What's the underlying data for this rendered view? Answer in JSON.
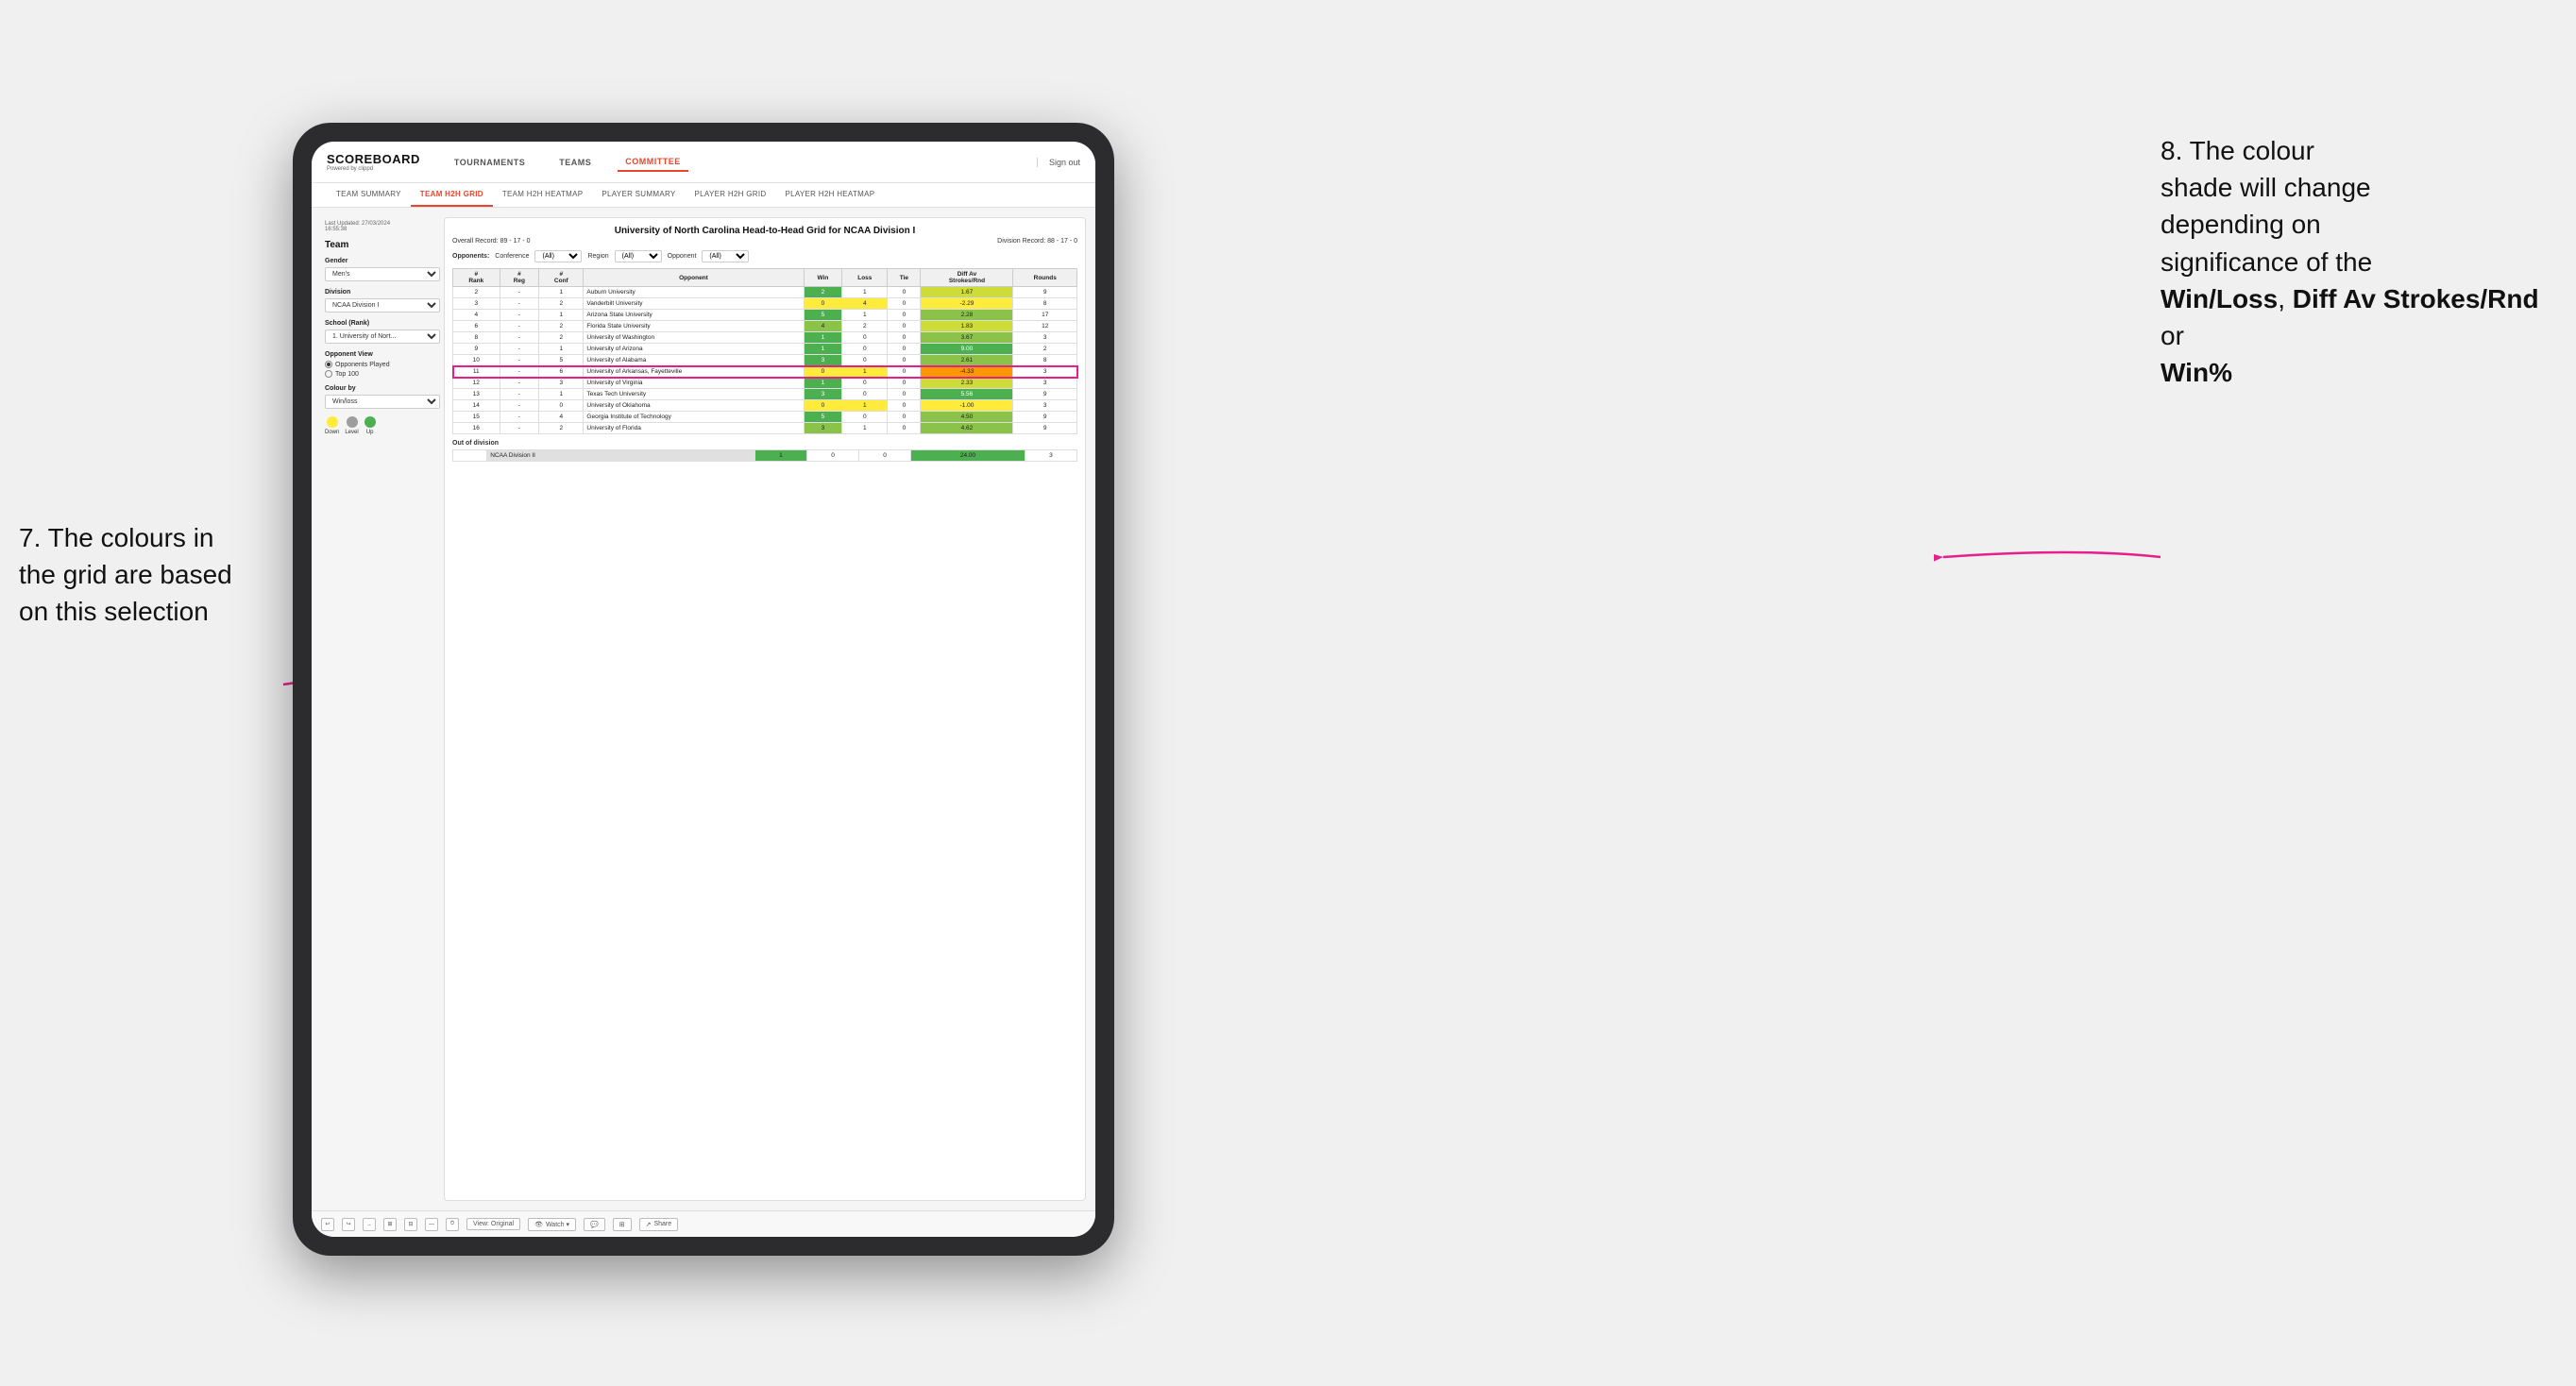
{
  "annotations": {
    "left": {
      "line1": "7. The colours in",
      "line2": "the grid are based",
      "line3": "on this selection"
    },
    "right": {
      "line1": "8. The colour",
      "line2": "shade will change",
      "line3": "depending on",
      "line4": "significance of the",
      "bold1": "Win/Loss",
      "comma1": ", ",
      "bold2": "Diff Av Strokes/Rnd",
      "or": " or",
      "bold3": "Win%"
    }
  },
  "header": {
    "logo": "SCOREBOARD",
    "logo_sub": "Powered by clippd",
    "nav": [
      "TOURNAMENTS",
      "TEAMS",
      "COMMITTEE"
    ],
    "active_nav": "COMMITTEE",
    "sign_out": "Sign out"
  },
  "sub_nav": {
    "items": [
      "TEAM SUMMARY",
      "TEAM H2H GRID",
      "TEAM H2H HEATMAP",
      "PLAYER SUMMARY",
      "PLAYER H2H GRID",
      "PLAYER H2H HEATMAP"
    ],
    "active": "TEAM H2H GRID"
  },
  "left_panel": {
    "update": "Last Updated: 27/03/2024",
    "update_time": "16:55:38",
    "team_label": "Team",
    "gender_label": "Gender",
    "gender_value": "Men's",
    "division_label": "Division",
    "division_value": "NCAA Division I",
    "school_label": "School (Rank)",
    "school_value": "1. University of Nort...",
    "opponent_view_label": "Opponent View",
    "opponent_options": [
      "Opponents Played",
      "Top 100"
    ],
    "opponent_selected": "Opponents Played",
    "colour_by_label": "Colour by",
    "colour_by_value": "Win/loss",
    "colours": [
      {
        "label": "Down",
        "color": "#ffeb3b"
      },
      {
        "label": "Level",
        "color": "#9e9e9e"
      },
      {
        "label": "Up",
        "color": "#4caf50"
      }
    ]
  },
  "grid": {
    "title": "University of North Carolina Head-to-Head Grid for NCAA Division I",
    "overall_record": "Overall Record: 89 - 17 - 0",
    "division_record": "Division Record: 88 - 17 - 0",
    "filter_opponents_label": "Opponents:",
    "filter_conference_label": "Conference",
    "filter_region_label": "Region",
    "filter_opponent_label": "Opponent",
    "filter_all": "(All)",
    "columns": [
      "#\nRank",
      "#\nReg",
      "#\nConf",
      "Opponent",
      "Win",
      "Loss",
      "Tie",
      "Diff Av\nStrokes/Rnd",
      "Rounds"
    ],
    "rows": [
      {
        "rank": "2",
        "reg": "-",
        "conf": "1",
        "opponent": "Auburn University",
        "win": "2",
        "loss": "1",
        "tie": "0",
        "diff": "1.67",
        "rounds": "9",
        "win_color": "green-dark",
        "diff_color": "green-light"
      },
      {
        "rank": "3",
        "reg": "-",
        "conf": "2",
        "opponent": "Vanderbilt University",
        "win": "0",
        "loss": "4",
        "tie": "0",
        "diff": "-2.29",
        "rounds": "8",
        "win_color": "yellow",
        "diff_color": "yellow"
      },
      {
        "rank": "4",
        "reg": "-",
        "conf": "1",
        "opponent": "Arizona State University",
        "win": "5",
        "loss": "1",
        "tie": "0",
        "diff": "2.28",
        "rounds": "17",
        "win_color": "green-dark",
        "diff_color": "green-mid"
      },
      {
        "rank": "6",
        "reg": "-",
        "conf": "2",
        "opponent": "Florida State University",
        "win": "4",
        "loss": "2",
        "tie": "0",
        "diff": "1.83",
        "rounds": "12",
        "win_color": "green-mid",
        "diff_color": "green-light"
      },
      {
        "rank": "8",
        "reg": "-",
        "conf": "2",
        "opponent": "University of Washington",
        "win": "1",
        "loss": "0",
        "tie": "0",
        "diff": "3.67",
        "rounds": "3",
        "win_color": "green-dark",
        "diff_color": "green-mid"
      },
      {
        "rank": "9",
        "reg": "-",
        "conf": "1",
        "opponent": "University of Arizona",
        "win": "1",
        "loss": "0",
        "tie": "0",
        "diff": "9.00",
        "rounds": "2",
        "win_color": "green-dark",
        "diff_color": "green-dark"
      },
      {
        "rank": "10",
        "reg": "-",
        "conf": "5",
        "opponent": "University of Alabama",
        "win": "3",
        "loss": "0",
        "tie": "0",
        "diff": "2.61",
        "rounds": "8",
        "win_color": "green-dark",
        "diff_color": "green-mid"
      },
      {
        "rank": "11",
        "reg": "-",
        "conf": "6",
        "opponent": "University of Arkansas, Fayetteville",
        "win": "0",
        "loss": "1",
        "tie": "0",
        "diff": "-4.33",
        "rounds": "3",
        "win_color": "yellow",
        "diff_color": "orange",
        "highlighted": true
      },
      {
        "rank": "12",
        "reg": "-",
        "conf": "3",
        "opponent": "University of Virginia",
        "win": "1",
        "loss": "0",
        "tie": "0",
        "diff": "2.33",
        "rounds": "3",
        "win_color": "green-dark",
        "diff_color": "green-light"
      },
      {
        "rank": "13",
        "reg": "-",
        "conf": "1",
        "opponent": "Texas Tech University",
        "win": "3",
        "loss": "0",
        "tie": "0",
        "diff": "5.56",
        "rounds": "9",
        "win_color": "green-dark",
        "diff_color": "green-dark"
      },
      {
        "rank": "14",
        "reg": "-",
        "conf": "0",
        "opponent": "University of Oklahoma",
        "win": "0",
        "loss": "1",
        "tie": "0",
        "diff": "-1.00",
        "rounds": "3",
        "win_color": "yellow",
        "diff_color": "yellow"
      },
      {
        "rank": "15",
        "reg": "-",
        "conf": "4",
        "opponent": "Georgia Institute of Technology",
        "win": "5",
        "loss": "0",
        "tie": "0",
        "diff": "4.50",
        "rounds": "9",
        "win_color": "green-dark",
        "diff_color": "green-mid"
      },
      {
        "rank": "16",
        "reg": "-",
        "conf": "2",
        "opponent": "University of Florida",
        "win": "3",
        "loss": "1",
        "tie": "0",
        "diff": "4.62",
        "rounds": "9",
        "win_color": "green-mid",
        "diff_color": "green-mid"
      }
    ],
    "out_of_division_label": "Out of division",
    "out_of_division_rows": [
      {
        "division": "NCAA Division II",
        "win": "1",
        "loss": "0",
        "tie": "0",
        "diff": "24.00",
        "rounds": "3",
        "diff_color": "green-dark"
      }
    ]
  },
  "toolbar": {
    "view_label": "View: Original",
    "watch_label": "Watch ▾",
    "share_label": "Share"
  }
}
